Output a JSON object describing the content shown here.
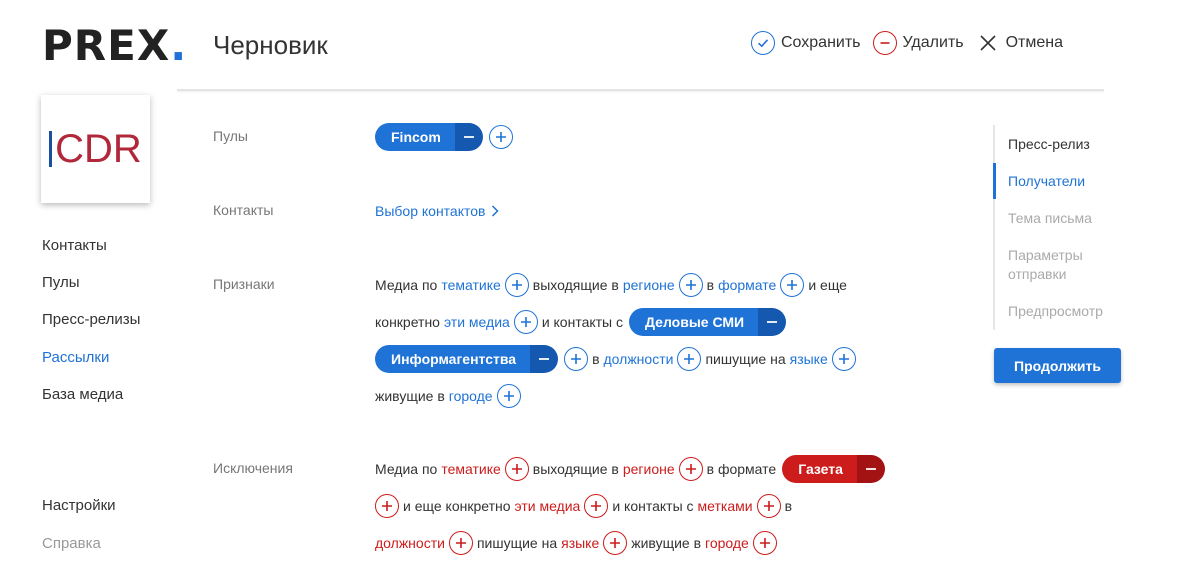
{
  "brand": {
    "name": "PREX",
    "dot": "."
  },
  "header": {
    "title": "Черновик",
    "save_label": "Сохранить",
    "delete_label": "Удалить",
    "cancel_label": "Отмена"
  },
  "avatar": {
    "text": "CDR",
    "bar_color": "#1a4fa0",
    "text_color": "#b0283a"
  },
  "nav": {
    "items": [
      {
        "label": "Контакты"
      },
      {
        "label": "Пулы"
      },
      {
        "label": "Пресс-релизы"
      },
      {
        "label": "Рассылки",
        "active": true
      },
      {
        "label": "База медиа"
      }
    ],
    "settings_label": "Настройки",
    "help_label": "Справка"
  },
  "form": {
    "pools": {
      "label": "Пулы",
      "chip": "Fincom"
    },
    "contacts": {
      "label": "Контакты",
      "link": "Выбор контактов"
    },
    "signs": {
      "label": "Признаки",
      "t_media_po": "Медиа по",
      "l_tematike": "тематике",
      "t_vyhodyashie": "выходящие в",
      "l_regione": "регионе",
      "t_v": "в",
      "l_formate": "формате",
      "t_i_eshe": "и еще",
      "t_konkretno": "конкретно",
      "l_eti_media": "эти медиа",
      "t_i_kontakty_s": "и контакты с",
      "chip_business": "Деловые СМИ",
      "chip_agencies": "Информагентства",
      "t_v2": "в",
      "l_dolzhnosti": "должности",
      "t_pishushie_na": "пишущие на",
      "l_yazyke": "языке",
      "t_zhivushie_v": "живущие в",
      "l_gorode": "городе"
    },
    "exclusions": {
      "label": "Исключения",
      "t_media_po": "Медиа по",
      "l_tematike": "тематике",
      "t_vyhodyashie": "выходящие в",
      "l_regione": "регионе",
      "t_v_formate": "в формате",
      "chip_newspaper": "Газета",
      "t_i_eshe_konkretno": "и еще конкретно",
      "l_eti_media": "эти медиа",
      "t_i_kontakty_s": "и контакты с",
      "l_metkami": "метками",
      "t_v": "в",
      "l_dolzhnosti": "должности",
      "t_pishushie_na": "пишущие на",
      "l_yazyke": "языке",
      "t_zhivushie_v": "живущие в",
      "l_gorode": "городе"
    }
  },
  "steps": {
    "items": [
      {
        "label": "Пресс-релиз",
        "state": "done"
      },
      {
        "label": "Получатели",
        "state": "active"
      },
      {
        "label": "Тема письма",
        "state": "disabled"
      },
      {
        "label": "Параметры отправки",
        "state": "disabled"
      },
      {
        "label": "Предпросмотр",
        "state": "disabled"
      }
    ],
    "continue_label": "Продолжить"
  },
  "colors": {
    "accent": "#1f73d6",
    "accent_dark": "#1558b0",
    "danger": "#cc1c1c",
    "danger_dark": "#a31313"
  }
}
